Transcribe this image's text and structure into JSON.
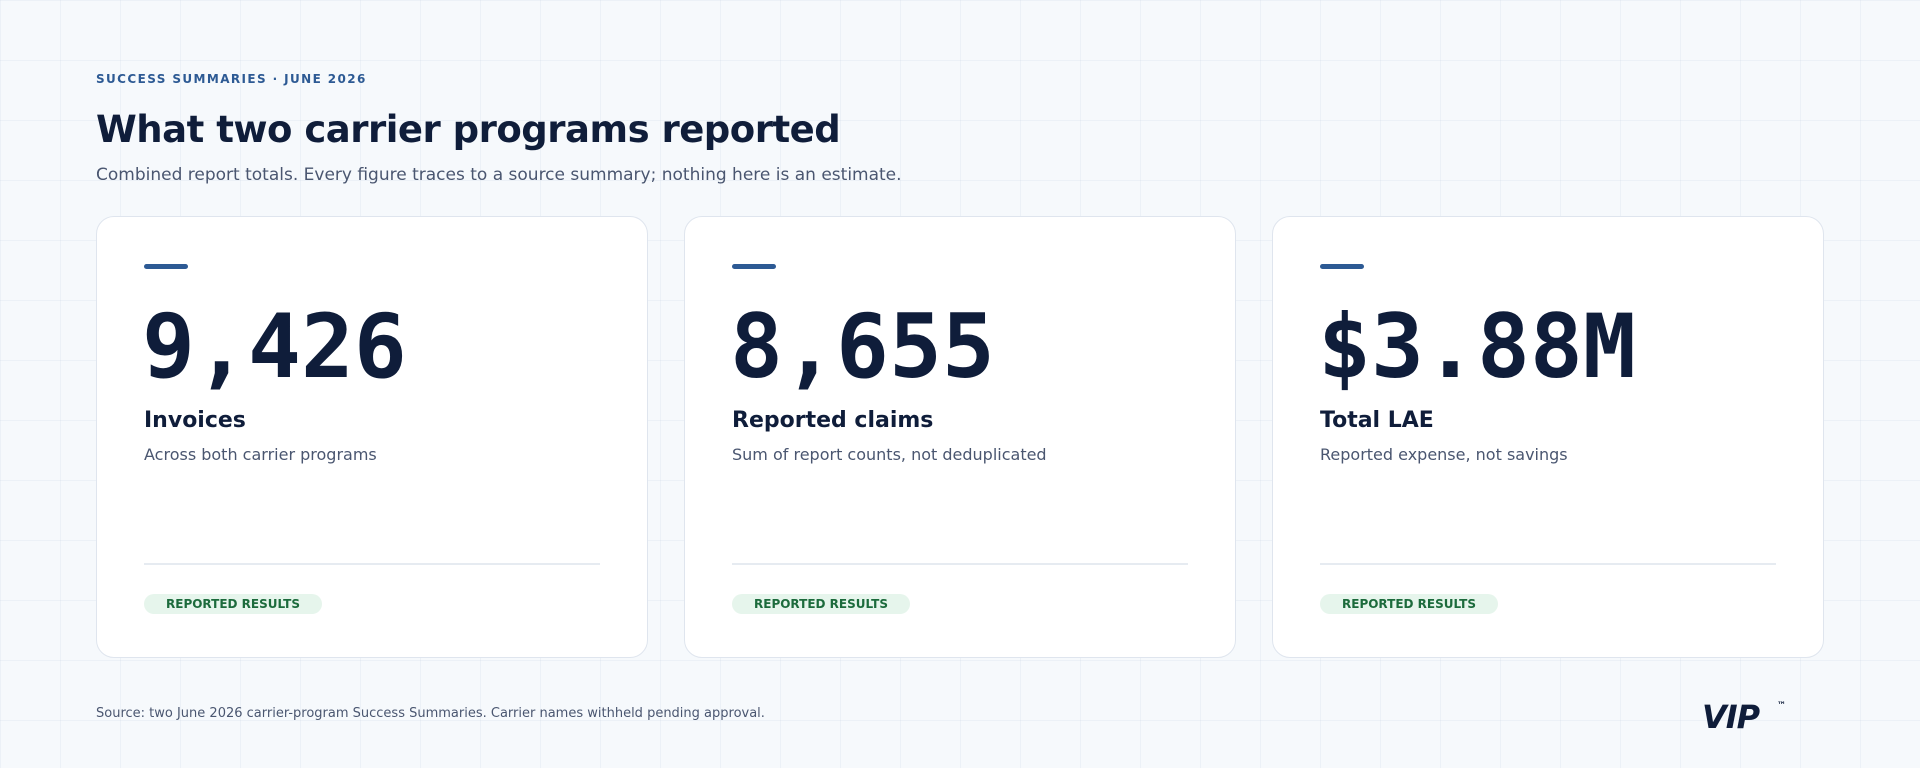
{
  "header": {
    "eyebrow": "SUCCESS SUMMARIES · JUNE 2026",
    "title": "What two carrier programs reported",
    "subtitle": "Combined report totals. Every figure traces to a source summary; nothing here is an estimate."
  },
  "cards": [
    {
      "value": "9,426",
      "label": "Invoices",
      "note": "Across both carrier programs",
      "badge": "REPORTED RESULTS"
    },
    {
      "value": "8,655",
      "label": "Reported claims",
      "note": "Sum of report counts, not deduplicated",
      "badge": "REPORTED RESULTS"
    },
    {
      "value": "$3.88M",
      "label": "Total LAE",
      "note": "Reported expense, not savings",
      "badge": "REPORTED RESULTS"
    }
  ],
  "footer": {
    "source": "Source: two June 2026 carrier-program Success Summaries. Carrier names withheld pending approval.",
    "logo_text": "VIP",
    "logo_mark": "™"
  },
  "colors": {
    "background": "#f6f9fc",
    "ink": "#0f1d3a",
    "accent": "#2d5a94",
    "muted": "#4a5670",
    "badge_bg": "#e6f5ec",
    "badge_text": "#1c6b3c"
  }
}
